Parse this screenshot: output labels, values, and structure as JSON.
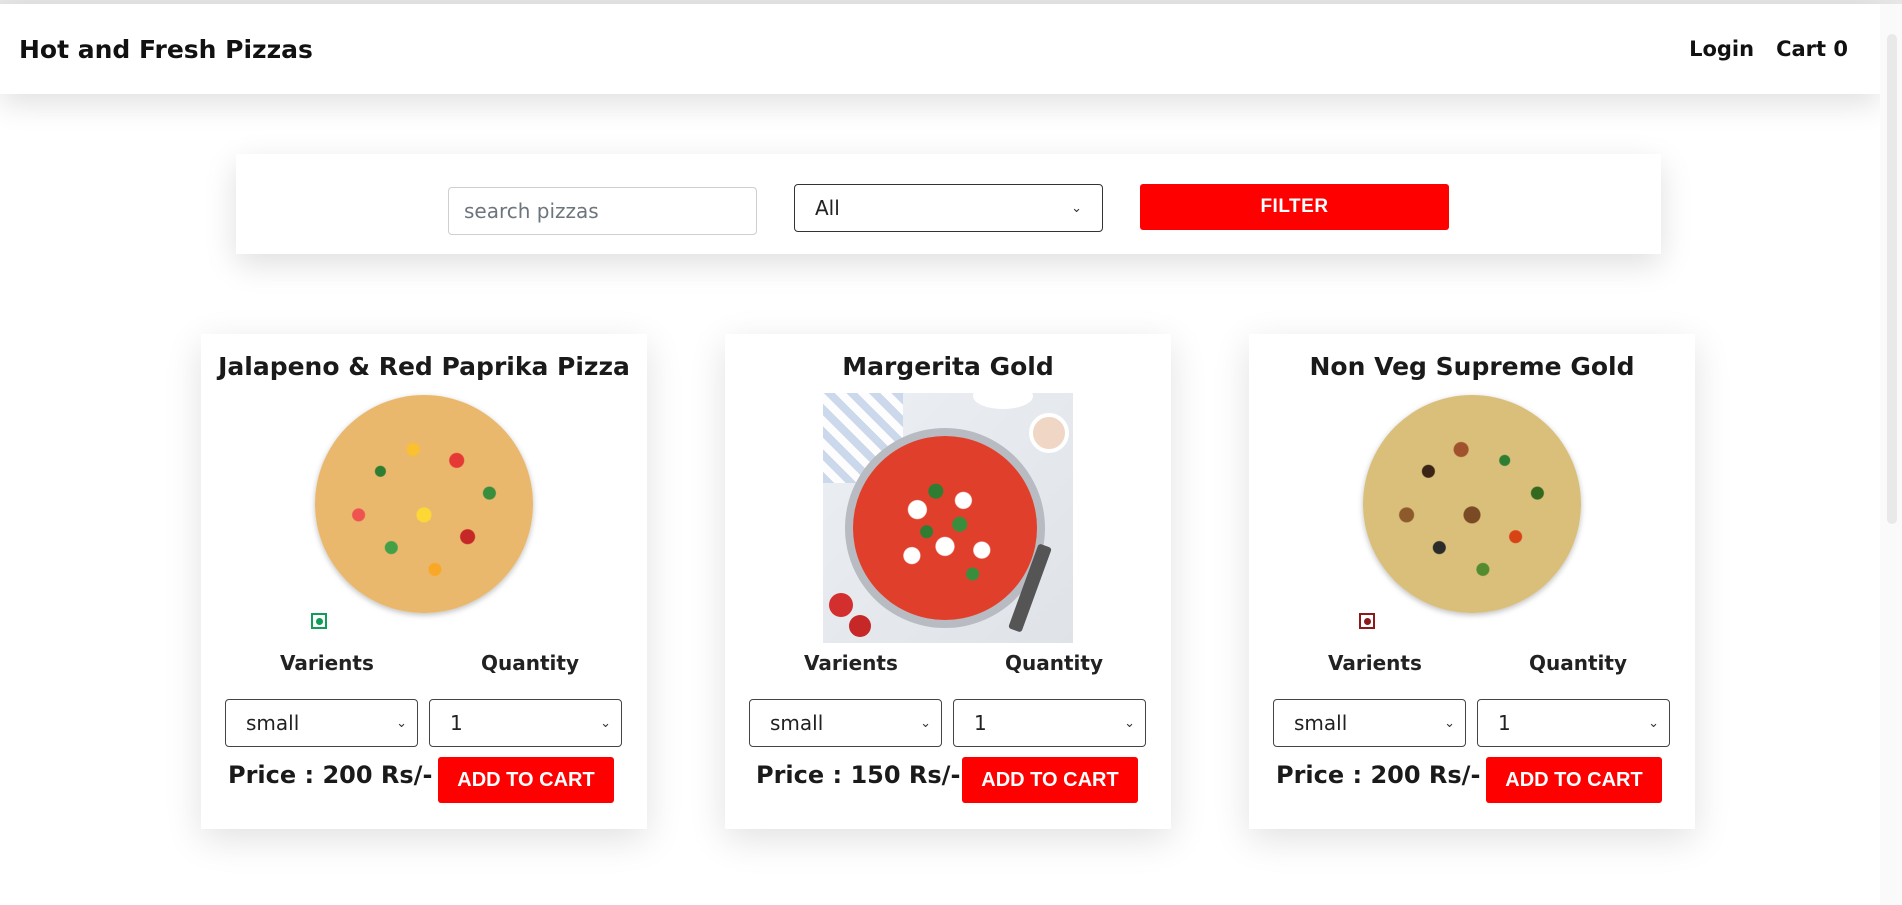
{
  "navbar": {
    "brand": "Hot and Fresh Pizzas",
    "login_label": "Login",
    "cart_label": "Cart 0"
  },
  "filter": {
    "search_placeholder": "search pizzas",
    "category_selected": "All",
    "filter_button": "FILTER"
  },
  "colors": {
    "accent": "#ff0000",
    "veg_mark": "#0f9d58",
    "nonveg_mark": "#8b1a1a"
  },
  "pizzas": [
    {
      "name": "Jalapeno & Red Paprika Pizza",
      "varients_label": "Varients",
      "quantity_label": "Quantity",
      "varient_selected": "small",
      "quantity_selected": "1",
      "price_text": "Price : 200 Rs/-",
      "add_button": "ADD TO CART",
      "image_icon": "pizza-veg",
      "mark": "veg"
    },
    {
      "name": "Margerita Gold",
      "varients_label": "Varients",
      "quantity_label": "Quantity",
      "varient_selected": "small",
      "quantity_selected": "1",
      "price_text": "Price : 150 Rs/-",
      "add_button": "ADD TO CART",
      "image_icon": "pizza-photo"
    },
    {
      "name": "Non Veg Supreme Gold",
      "varients_label": "Varients",
      "quantity_label": "Quantity",
      "varient_selected": "small",
      "quantity_selected": "1",
      "price_text": "Price : 200 Rs/-",
      "add_button": "ADD TO CART",
      "image_icon": "pizza-nonveg",
      "mark": "non-veg"
    }
  ]
}
